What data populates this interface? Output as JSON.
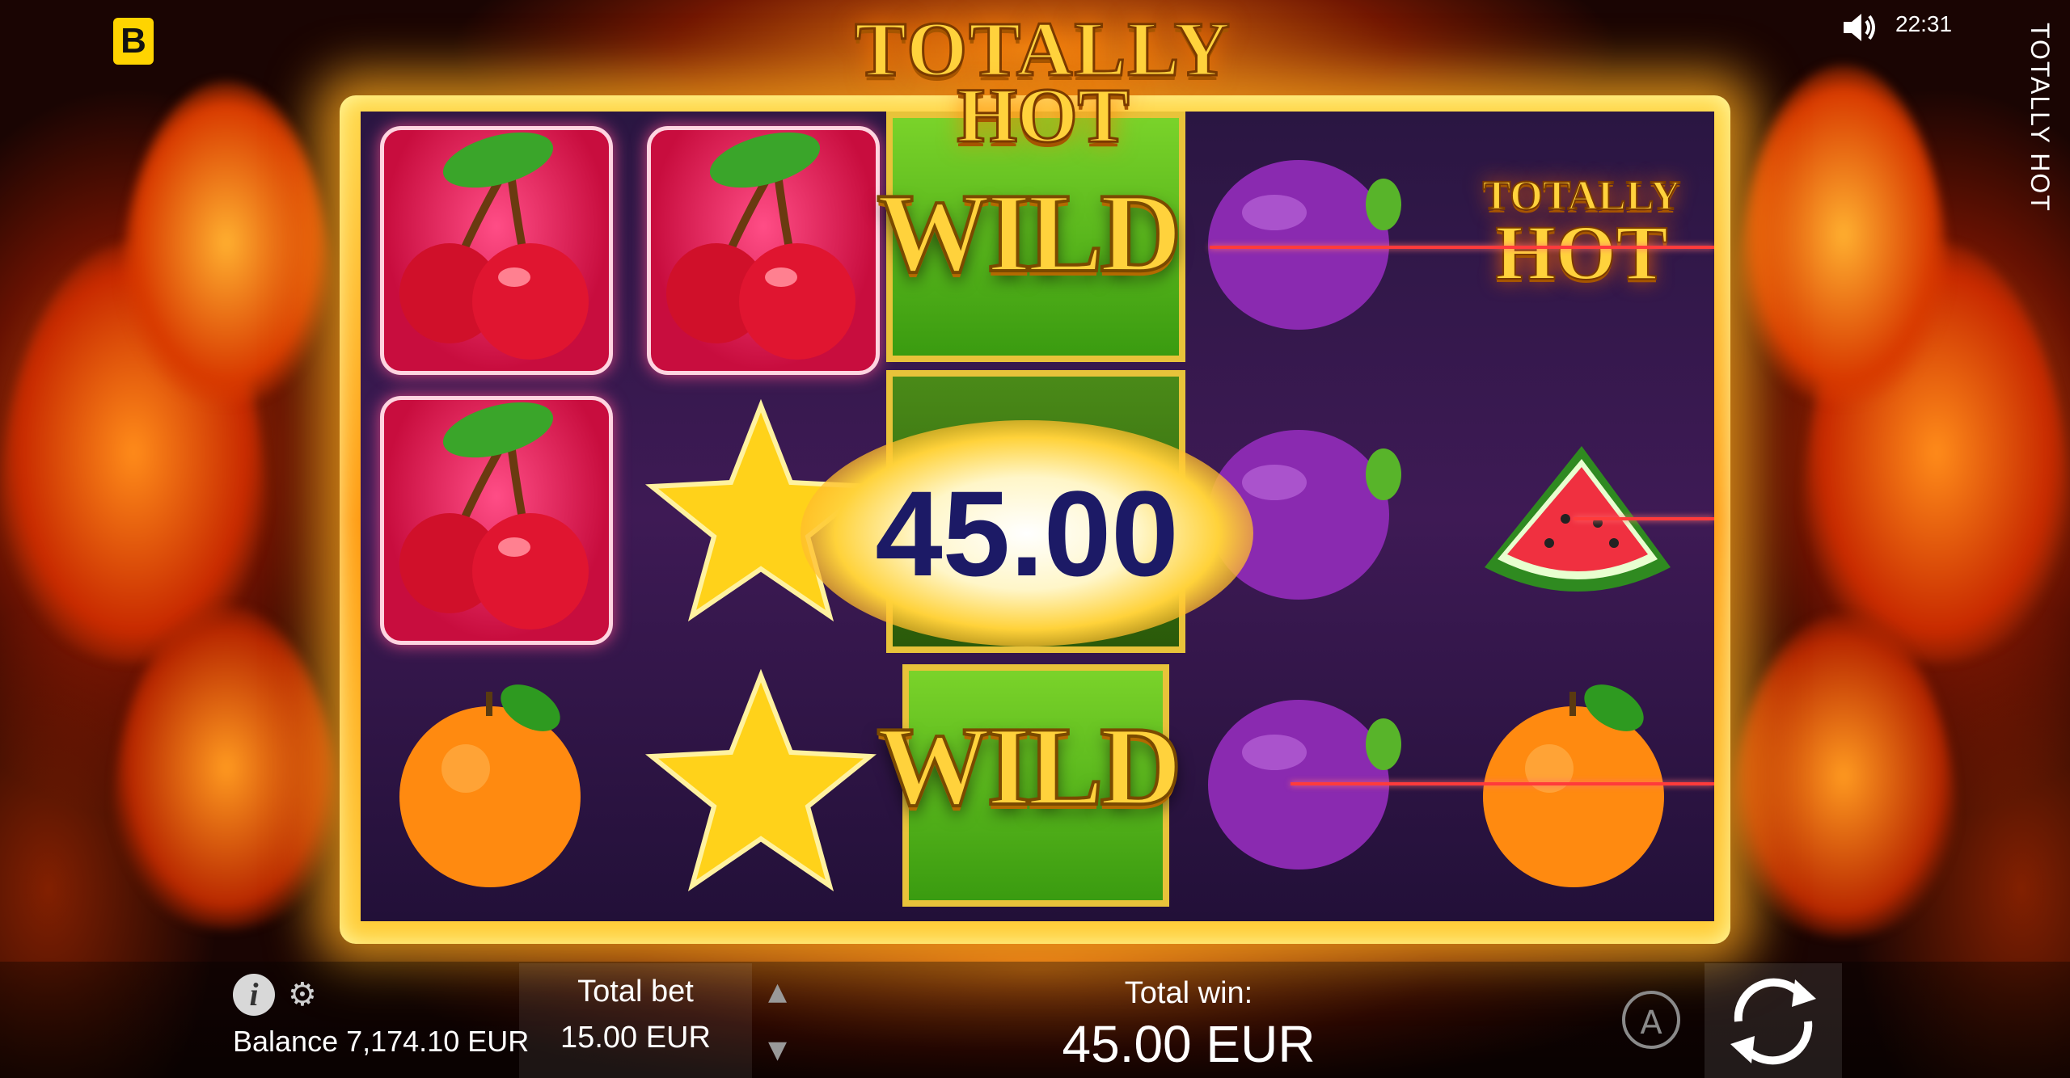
{
  "game": {
    "title_line1": "TOTALLY",
    "title_line2": "HOT",
    "side_title": "TOTALLY HOT",
    "brand_logo": "B",
    "clock": "22:31"
  },
  "reels": [
    [
      "cherry",
      "cherry",
      "orange"
    ],
    [
      "cherry",
      "star",
      "star"
    ],
    [
      "wild",
      "wild",
      "wild"
    ],
    [
      "plum",
      "plum",
      "plum"
    ],
    [
      "totally-hot",
      "watermelon",
      "orange"
    ]
  ],
  "symbols": {
    "wild_label": "WILD",
    "scatter_line1": "TOTALLY",
    "scatter_line2": "HOT"
  },
  "win_popup": "45.00",
  "bottom_bar": {
    "balance_label": "Balance 7,174.10 EUR",
    "total_bet_label": "Total bet",
    "total_bet_value": "15.00 EUR",
    "total_win_label": "Total win:",
    "total_win_value": "45.00 EUR",
    "autoplay_label": "A"
  },
  "colors": {
    "accent_gold": "#ffd23c",
    "win_text": "#1c1a66",
    "payline": "#ff3b3b",
    "logo_yellow": "#ffd400"
  }
}
